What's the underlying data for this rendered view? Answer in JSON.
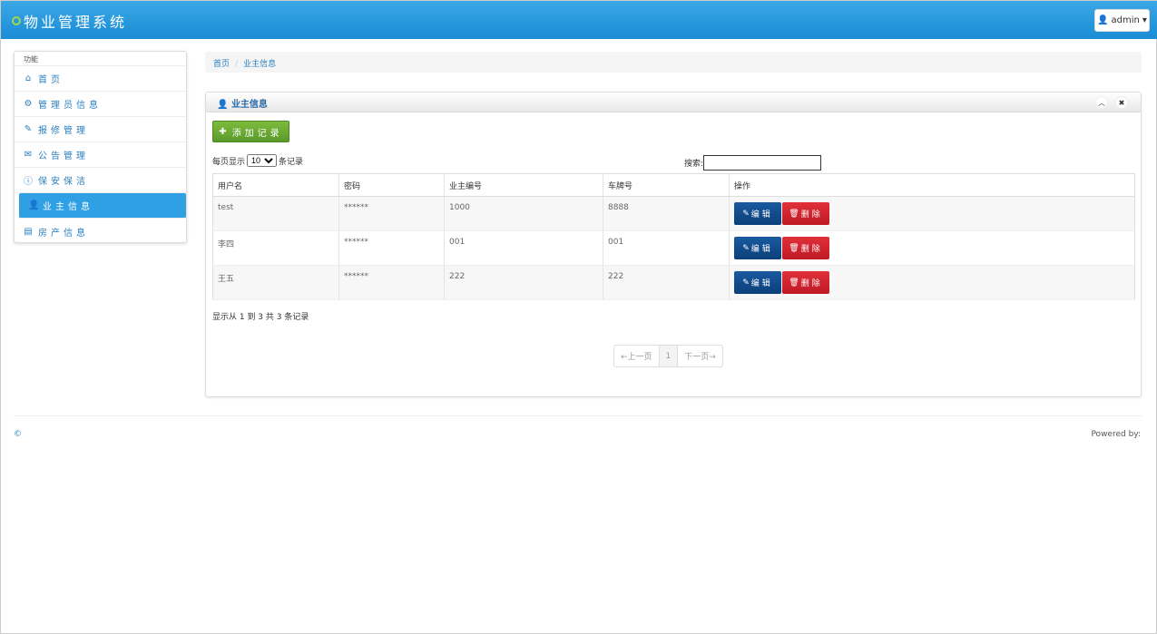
{
  "header": {
    "title": "物业管理系统",
    "user": "admin"
  },
  "sidebar": {
    "title": "功能",
    "items": [
      {
        "label": "首页",
        "icon": "home-icon"
      },
      {
        "label": "管理员信息",
        "icon": "gear-icon"
      },
      {
        "label": "报修管理",
        "icon": "wrench-icon"
      },
      {
        "label": "公告管理",
        "icon": "envelope-icon"
      },
      {
        "label": "保安保洁",
        "icon": "info-icon"
      },
      {
        "label": "业主信息",
        "icon": "user-icon"
      },
      {
        "label": "房产信息",
        "icon": "list-icon"
      }
    ]
  },
  "breadcrumb": {
    "home": "首页",
    "sep": "/",
    "current": "业主信息"
  },
  "panel": {
    "title": "业主信息",
    "add": "添加记录",
    "length_pre": "每页显示",
    "length_val": "10",
    "length_post": "条记录",
    "search_label": "搜索:",
    "search_value": "",
    "columns": [
      "用户名",
      "密码",
      "业主编号",
      "车牌号",
      "操作"
    ],
    "rows": [
      [
        "test",
        "******",
        "1000",
        "8888"
      ],
      [
        "李四",
        "******",
        "001",
        "001"
      ],
      [
        "王五",
        "******",
        "222",
        "222"
      ]
    ],
    "edit": "编辑",
    "delete": "删除",
    "info": "显示从 1 到 3 共 3 条记录",
    "prev": "←上一页",
    "page": "1",
    "next": "下一页→"
  },
  "footer": {
    "copy": "©",
    "powered": "Powered by:"
  },
  "colors": {
    "header": "#1b8dd6",
    "active": "#2fa0e4",
    "edit": "#0b3f7a",
    "delete": "#c01a25",
    "add": "#5a9a2a"
  }
}
